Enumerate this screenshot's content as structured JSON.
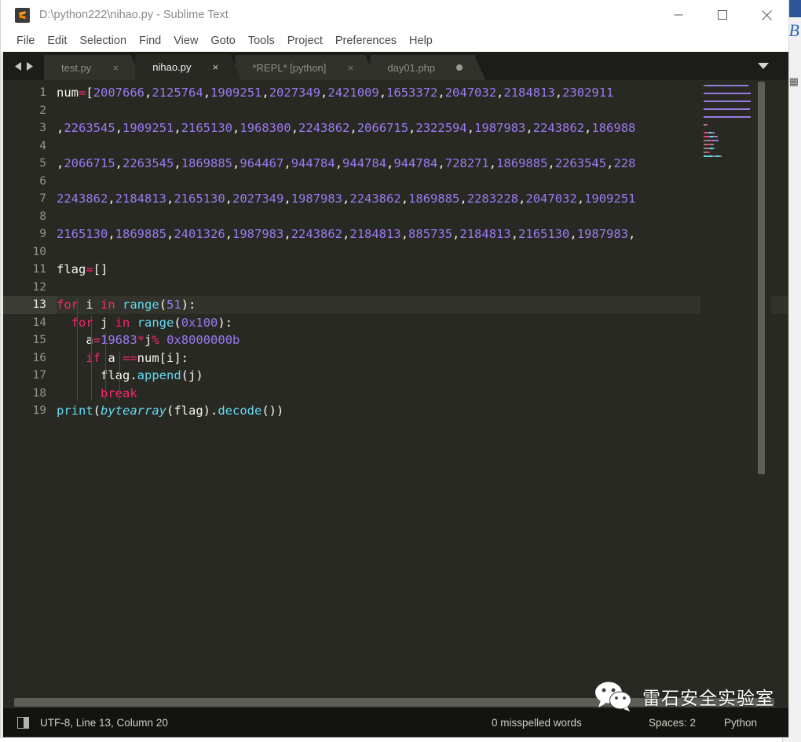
{
  "window": {
    "title": "D:\\python222\\nihao.py - Sublime Text",
    "app_icon": "sublime-logo-icon",
    "controls": {
      "minimize": "minimize-icon",
      "maximize": "maximize-icon",
      "close": "close-icon"
    }
  },
  "background_window": {
    "text": "B",
    "icon": "excel-icon"
  },
  "menubar": {
    "items": [
      {
        "label": "File"
      },
      {
        "label": "Edit"
      },
      {
        "label": "Selection"
      },
      {
        "label": "Find"
      },
      {
        "label": "View"
      },
      {
        "label": "Goto"
      },
      {
        "label": "Tools"
      },
      {
        "label": "Project"
      },
      {
        "label": "Preferences"
      },
      {
        "label": "Help"
      }
    ]
  },
  "tabbar": {
    "nav_prev": "chevron-left-icon",
    "nav_next": "chevron-right-icon",
    "dropdown": "chevron-down-icon",
    "close_glyph": "×",
    "tabs": [
      {
        "label": "test.py",
        "active": false,
        "dirty": false
      },
      {
        "label": "nihao.py",
        "active": true,
        "dirty": false
      },
      {
        "label": "*REPL* [python]",
        "active": false,
        "dirty": false
      },
      {
        "label": "day01.php",
        "active": false,
        "dirty": true
      }
    ]
  },
  "editor": {
    "current_line": 13,
    "line_count": 19,
    "lines": [
      {
        "n": 1,
        "tokens": [
          {
            "t": "plain",
            "v": "num"
          },
          {
            "t": "op",
            "v": "="
          },
          {
            "t": "punc",
            "v": "["
          },
          {
            "t": "num",
            "v": "2007666"
          },
          {
            "t": "punc",
            "v": ","
          },
          {
            "t": "num",
            "v": "2125764"
          },
          {
            "t": "punc",
            "v": ","
          },
          {
            "t": "num",
            "v": "1909251"
          },
          {
            "t": "punc",
            "v": ","
          },
          {
            "t": "num",
            "v": "2027349"
          },
          {
            "t": "punc",
            "v": ","
          },
          {
            "t": "num",
            "v": "2421009"
          },
          {
            "t": "punc",
            "v": ","
          },
          {
            "t": "num",
            "v": "1653372"
          },
          {
            "t": "punc",
            "v": ","
          },
          {
            "t": "num",
            "v": "2047032"
          },
          {
            "t": "punc",
            "v": ","
          },
          {
            "t": "num",
            "v": "2184813"
          },
          {
            "t": "punc",
            "v": ","
          },
          {
            "t": "num",
            "v": "2302911"
          }
        ]
      },
      {
        "n": 2,
        "tokens": []
      },
      {
        "n": 3,
        "tokens": [
          {
            "t": "punc",
            "v": ","
          },
          {
            "t": "num",
            "v": "2263545"
          },
          {
            "t": "punc",
            "v": ","
          },
          {
            "t": "num",
            "v": "1909251"
          },
          {
            "t": "punc",
            "v": ","
          },
          {
            "t": "num",
            "v": "2165130"
          },
          {
            "t": "punc",
            "v": ","
          },
          {
            "t": "num",
            "v": "1968300"
          },
          {
            "t": "punc",
            "v": ","
          },
          {
            "t": "num",
            "v": "2243862"
          },
          {
            "t": "punc",
            "v": ","
          },
          {
            "t": "num",
            "v": "2066715"
          },
          {
            "t": "punc",
            "v": ","
          },
          {
            "t": "num",
            "v": "2322594"
          },
          {
            "t": "punc",
            "v": ","
          },
          {
            "t": "num",
            "v": "1987983"
          },
          {
            "t": "punc",
            "v": ","
          },
          {
            "t": "num",
            "v": "2243862"
          },
          {
            "t": "punc",
            "v": ","
          },
          {
            "t": "num",
            "v": "186988"
          }
        ]
      },
      {
        "n": 4,
        "tokens": []
      },
      {
        "n": 5,
        "tokens": [
          {
            "t": "punc",
            "v": ","
          },
          {
            "t": "num",
            "v": "2066715"
          },
          {
            "t": "punc",
            "v": ","
          },
          {
            "t": "num",
            "v": "2263545"
          },
          {
            "t": "punc",
            "v": ","
          },
          {
            "t": "num",
            "v": "1869885"
          },
          {
            "t": "punc",
            "v": ","
          },
          {
            "t": "num",
            "v": "964467"
          },
          {
            "t": "punc",
            "v": ","
          },
          {
            "t": "num",
            "v": "944784"
          },
          {
            "t": "punc",
            "v": ","
          },
          {
            "t": "num",
            "v": "944784"
          },
          {
            "t": "punc",
            "v": ","
          },
          {
            "t": "num",
            "v": "944784"
          },
          {
            "t": "punc",
            "v": ","
          },
          {
            "t": "num",
            "v": "728271"
          },
          {
            "t": "punc",
            "v": ","
          },
          {
            "t": "num",
            "v": "1869885"
          },
          {
            "t": "punc",
            "v": ","
          },
          {
            "t": "num",
            "v": "2263545"
          },
          {
            "t": "punc",
            "v": ","
          },
          {
            "t": "num",
            "v": "228"
          }
        ]
      },
      {
        "n": 6,
        "tokens": []
      },
      {
        "n": 7,
        "tokens": [
          {
            "t": "num",
            "v": "2243862"
          },
          {
            "t": "punc",
            "v": ","
          },
          {
            "t": "num",
            "v": "2184813"
          },
          {
            "t": "punc",
            "v": ","
          },
          {
            "t": "num",
            "v": "2165130"
          },
          {
            "t": "punc",
            "v": ","
          },
          {
            "t": "num",
            "v": "2027349"
          },
          {
            "t": "punc",
            "v": ","
          },
          {
            "t": "num",
            "v": "1987983"
          },
          {
            "t": "punc",
            "v": ","
          },
          {
            "t": "num",
            "v": "2243862"
          },
          {
            "t": "punc",
            "v": ","
          },
          {
            "t": "num",
            "v": "1869885"
          },
          {
            "t": "punc",
            "v": ","
          },
          {
            "t": "num",
            "v": "2283228"
          },
          {
            "t": "punc",
            "v": ","
          },
          {
            "t": "num",
            "v": "2047032"
          },
          {
            "t": "punc",
            "v": ","
          },
          {
            "t": "num",
            "v": "1909251"
          }
        ]
      },
      {
        "n": 8,
        "tokens": []
      },
      {
        "n": 9,
        "tokens": [
          {
            "t": "num",
            "v": "2165130"
          },
          {
            "t": "punc",
            "v": ","
          },
          {
            "t": "num",
            "v": "1869885"
          },
          {
            "t": "punc",
            "v": ","
          },
          {
            "t": "num",
            "v": "2401326"
          },
          {
            "t": "punc",
            "v": ","
          },
          {
            "t": "num",
            "v": "1987983"
          },
          {
            "t": "punc",
            "v": ","
          },
          {
            "t": "num",
            "v": "2243862"
          },
          {
            "t": "punc",
            "v": ","
          },
          {
            "t": "num",
            "v": "2184813"
          },
          {
            "t": "punc",
            "v": ","
          },
          {
            "t": "num",
            "v": "885735"
          },
          {
            "t": "punc",
            "v": ","
          },
          {
            "t": "num",
            "v": "2184813"
          },
          {
            "t": "punc",
            "v": ","
          },
          {
            "t": "num",
            "v": "2165130"
          },
          {
            "t": "punc",
            "v": ","
          },
          {
            "t": "num",
            "v": "1987983"
          },
          {
            "t": "punc",
            "v": ","
          }
        ]
      },
      {
        "n": 10,
        "tokens": []
      },
      {
        "n": 11,
        "tokens": [
          {
            "t": "plain",
            "v": "flag"
          },
          {
            "t": "op",
            "v": "="
          },
          {
            "t": "punc",
            "v": "[]"
          }
        ]
      },
      {
        "n": 12,
        "tokens": []
      },
      {
        "n": 13,
        "tokens": [
          {
            "t": "kw",
            "v": "for"
          },
          {
            "t": "plain",
            "v": " i "
          },
          {
            "t": "kw",
            "v": "in"
          },
          {
            "t": "plain",
            "v": " "
          },
          {
            "t": "call",
            "v": "range"
          },
          {
            "t": "punc",
            "v": "("
          },
          {
            "t": "num",
            "v": "51"
          },
          {
            "t": "punc",
            "v": "):"
          }
        ]
      },
      {
        "n": 14,
        "tokens": [
          {
            "t": "plain",
            "v": "  "
          },
          {
            "t": "kw",
            "v": "for"
          },
          {
            "t": "plain",
            "v": " j "
          },
          {
            "t": "kw",
            "v": "in"
          },
          {
            "t": "plain",
            "v": " "
          },
          {
            "t": "call",
            "v": "range"
          },
          {
            "t": "punc",
            "v": "("
          },
          {
            "t": "num",
            "v": "0x100"
          },
          {
            "t": "punc",
            "v": "):"
          }
        ]
      },
      {
        "n": 15,
        "tokens": [
          {
            "t": "plain",
            "v": "    a"
          },
          {
            "t": "op",
            "v": "="
          },
          {
            "t": "num",
            "v": "19683"
          },
          {
            "t": "op",
            "v": "*"
          },
          {
            "t": "plain",
            "v": "j"
          },
          {
            "t": "op",
            "v": "%"
          },
          {
            "t": "plain",
            "v": " "
          },
          {
            "t": "num",
            "v": "0x8000000b"
          }
        ]
      },
      {
        "n": 16,
        "tokens": [
          {
            "t": "plain",
            "v": "    "
          },
          {
            "t": "kw",
            "v": "if"
          },
          {
            "t": "plain",
            "v": " a "
          },
          {
            "t": "op",
            "v": "=="
          },
          {
            "t": "plain",
            "v": "num[i]:"
          }
        ]
      },
      {
        "n": 17,
        "tokens": [
          {
            "t": "plain",
            "v": "      flag."
          },
          {
            "t": "call",
            "v": "append"
          },
          {
            "t": "punc",
            "v": "(j)"
          }
        ]
      },
      {
        "n": 18,
        "tokens": [
          {
            "t": "plain",
            "v": "      "
          },
          {
            "t": "kw",
            "v": "break"
          }
        ]
      },
      {
        "n": 19,
        "tokens": [
          {
            "t": "call",
            "v": "print"
          },
          {
            "t": "punc",
            "v": "("
          },
          {
            "t": "ital",
            "v": "bytearray"
          },
          {
            "t": "punc",
            "v": "(flag)."
          },
          {
            "t": "call",
            "v": "decode"
          },
          {
            "t": "punc",
            "v": "())"
          }
        ]
      }
    ]
  },
  "statusbar": {
    "icon": "sidebar-toggle-icon",
    "encoding_position": "UTF-8, Line 13, Column 20",
    "spelling": "0 misspelled words",
    "indentation": "Spaces: 2",
    "syntax": "Python"
  },
  "watermark": {
    "icon": "wechat-icon",
    "text": "雷石安全实验室"
  },
  "colors": {
    "editor_bg": "#282923",
    "gutter_text": "#949488",
    "current_line_bg": "#32332b",
    "number_token": "#9a79ef",
    "keyword_token": "#f92672",
    "function_token": "#66d9ef",
    "plain_token": "#f6f6ee",
    "tabbar_bg": "#1c1d18",
    "statusbar_bg": "#13140f",
    "titlebar_bg": "#ffffff"
  }
}
